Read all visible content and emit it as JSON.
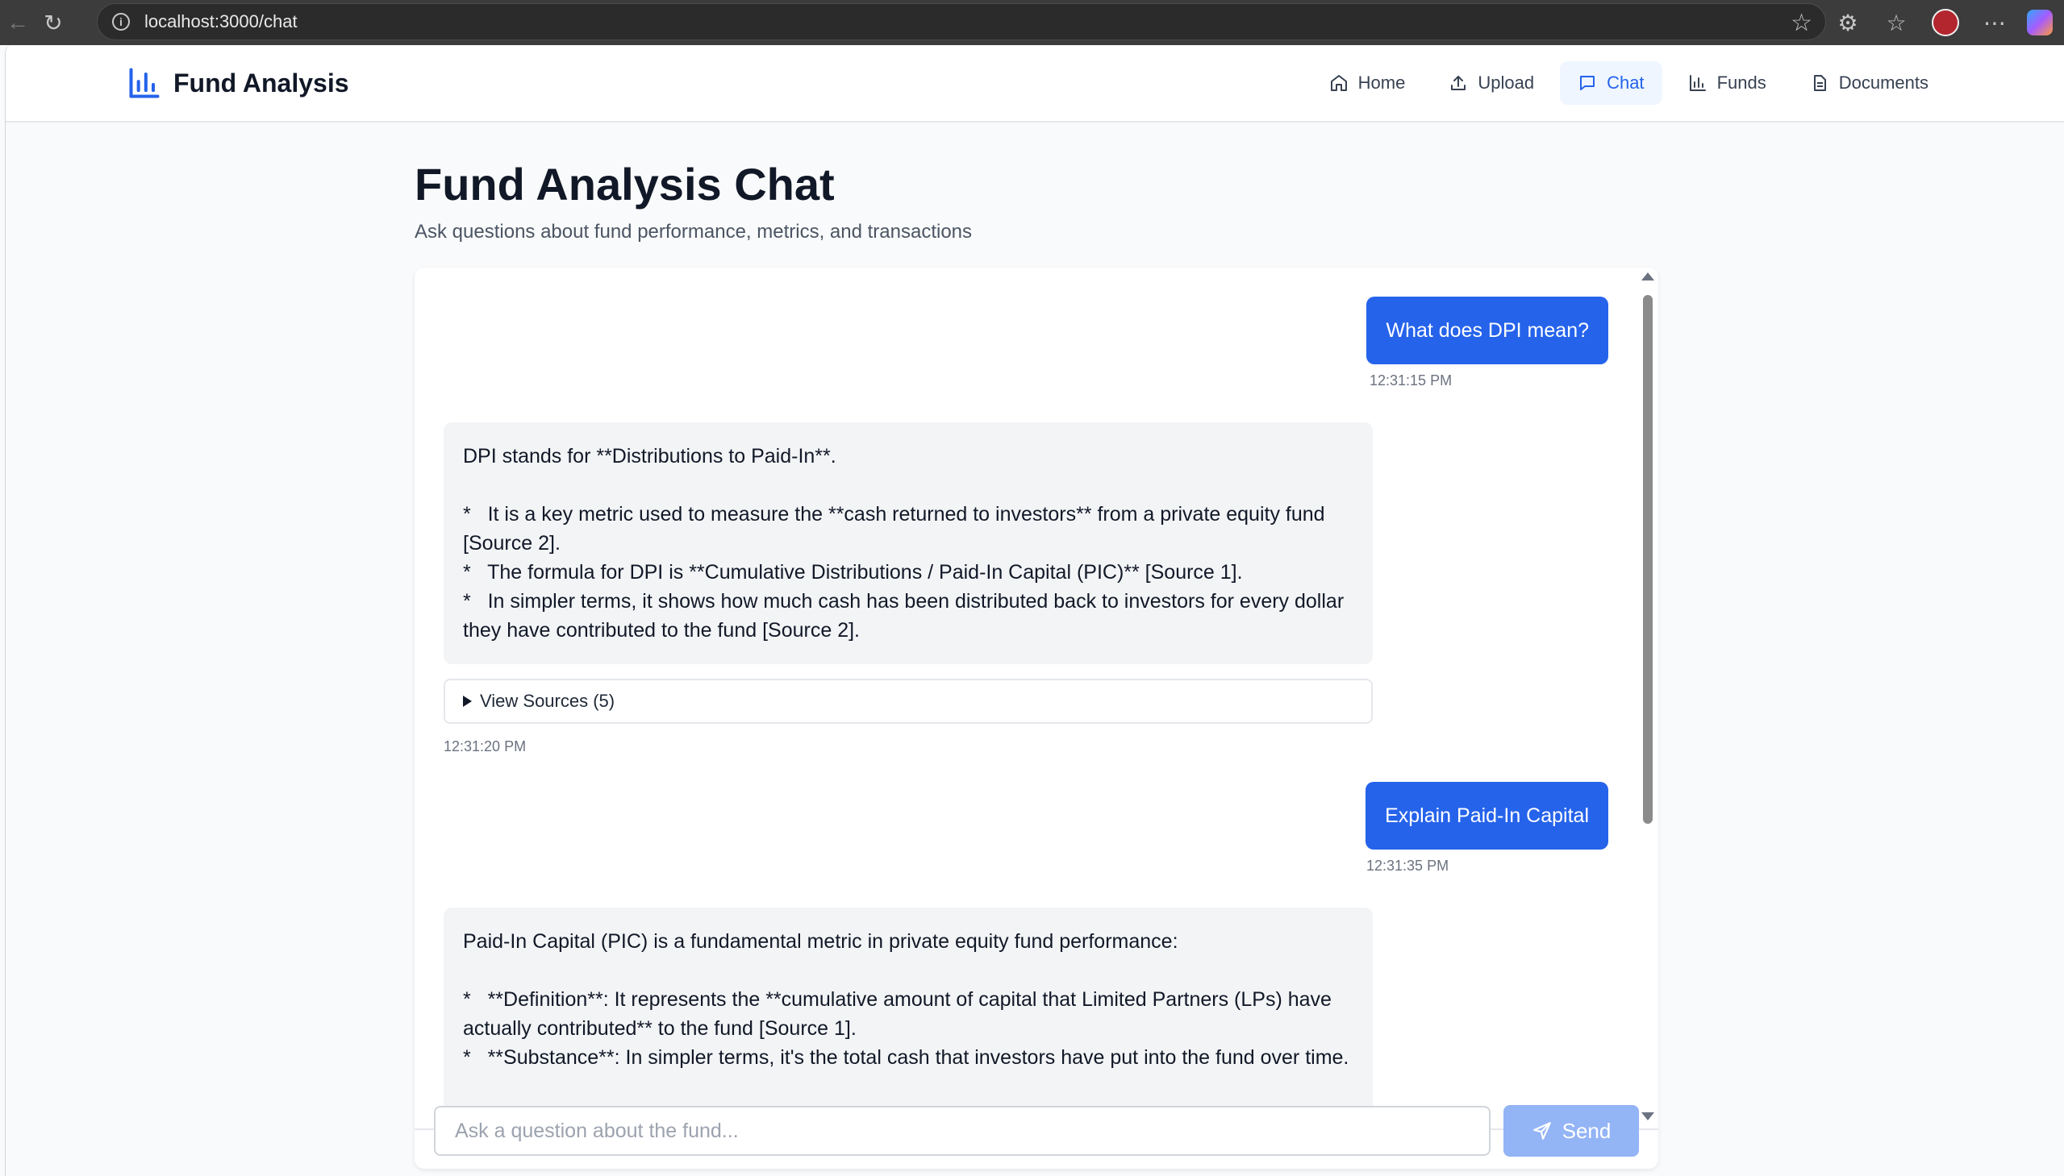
{
  "browser": {
    "url": "localhost:3000/chat"
  },
  "nav": {
    "brand": "Fund Analysis",
    "links": [
      {
        "label": "Home",
        "icon": "home-icon"
      },
      {
        "label": "Upload",
        "icon": "upload-icon"
      },
      {
        "label": "Chat",
        "icon": "chat-icon",
        "active": true
      },
      {
        "label": "Funds",
        "icon": "bar-chart-icon"
      },
      {
        "label": "Documents",
        "icon": "document-icon"
      }
    ]
  },
  "page": {
    "title": "Fund Analysis Chat",
    "subtitle": "Ask questions about fund performance, metrics, and transactions"
  },
  "messages": [
    {
      "role": "user",
      "text": "What does DPI mean?",
      "time": "12:31:15 PM"
    },
    {
      "role": "assistant",
      "text": "DPI stands for **Distributions to Paid-In**.\n\n*   It is a key metric used to measure the **cash returned to investors** from a private equity fund [Source 2].\n*   The formula for DPI is **Cumulative Distributions / Paid-In Capital (PIC)** [Source 1].\n*   In simpler terms, it shows how much cash has been distributed back to investors for every dollar they have contributed to the fund [Source 2].",
      "sources_label": "View Sources (5)",
      "time": "12:31:20 PM"
    },
    {
      "role": "user",
      "text": "Explain Paid-In Capital",
      "time": "12:31:35 PM"
    },
    {
      "role": "assistant",
      "text": "Paid-In Capital (PIC) is a fundamental metric in private equity fund performance:\n\n*   **Definition**: It represents the **cumulative amount of capital that Limited Partners (LPs) have actually contributed** to the fund [Source 1].\n*   **Substance**: In simpler terms, it's the total cash that investors have put into the fund over time."
    }
  ],
  "input": {
    "placeholder": "Ask a question about the fund...",
    "send_label": "Send"
  },
  "colors": {
    "accent": "#2563eb",
    "send_disabled": "#93b4f5",
    "assistant_bg": "#f3f4f6"
  }
}
